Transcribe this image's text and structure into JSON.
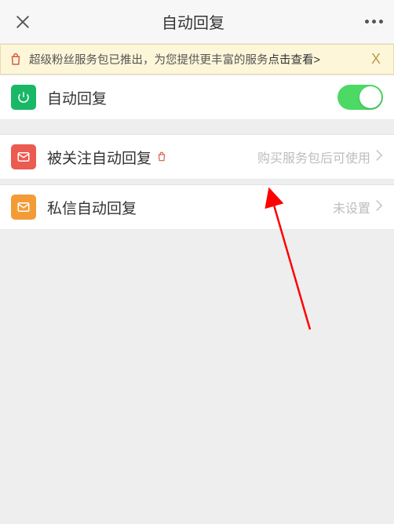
{
  "header": {
    "title": "自动回复"
  },
  "banner": {
    "text": "超级粉丝服务包已推出，为您提供更丰富的服务",
    "link": "点击查看>",
    "close": "X"
  },
  "toggle_row": {
    "label": "自动回复",
    "on": true
  },
  "rows": [
    {
      "label": "被关注自动回复",
      "hint": "购买服务包后可使用"
    },
    {
      "label": "私信自动回复",
      "hint": "未设置"
    }
  ]
}
